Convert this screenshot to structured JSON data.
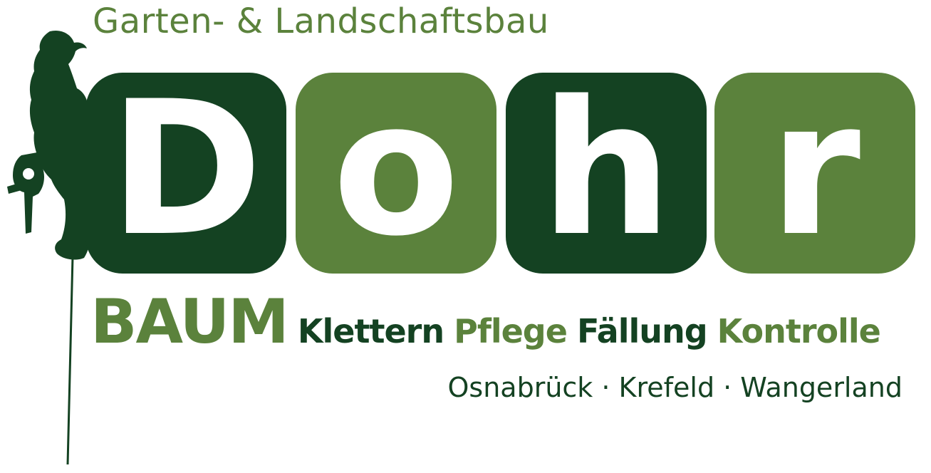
{
  "header": {
    "tagline": "Garten- & Landschaftsbau"
  },
  "logo": {
    "letters": [
      "D",
      "o",
      "h",
      "r"
    ],
    "colors": {
      "dark_green": "#144222",
      "light_green": "#5b823c"
    }
  },
  "services": {
    "lead": "BAUM",
    "items": [
      "Klettern",
      "Pflege",
      "Fällung",
      "Kontrolle"
    ]
  },
  "locations": {
    "text": "Osnabrück · Krefeld · Wangerland"
  },
  "illustration": {
    "icon": "tree-climber-silhouette-icon"
  }
}
